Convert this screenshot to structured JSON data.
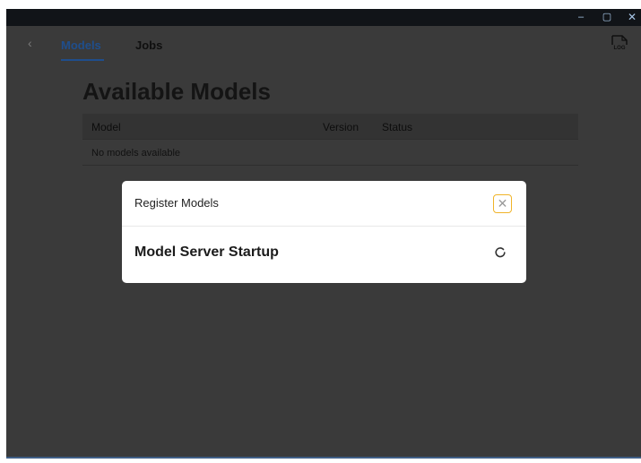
{
  "window_controls": {
    "minimize": "–",
    "maximize": "▢",
    "close": "✕"
  },
  "nav": {
    "back_icon": "‹",
    "tabs": [
      {
        "label": "Models",
        "active": true
      },
      {
        "label": "Jobs",
        "active": false
      }
    ],
    "log_label": "LOG"
  },
  "page": {
    "title": "Available Models"
  },
  "table": {
    "columns": [
      "Model",
      "Version",
      "Status"
    ],
    "empty_message": "No models available"
  },
  "modal": {
    "title": "Register Models",
    "close_icon": "✕",
    "heading": "Model Server Startup",
    "spinner_icon": "loading-spinner-icon"
  },
  "colors": {
    "accent": "#1f4e8c",
    "close_border": "#f0b429",
    "overlay": "#3a3a3a",
    "titlebar": "#111418"
  }
}
